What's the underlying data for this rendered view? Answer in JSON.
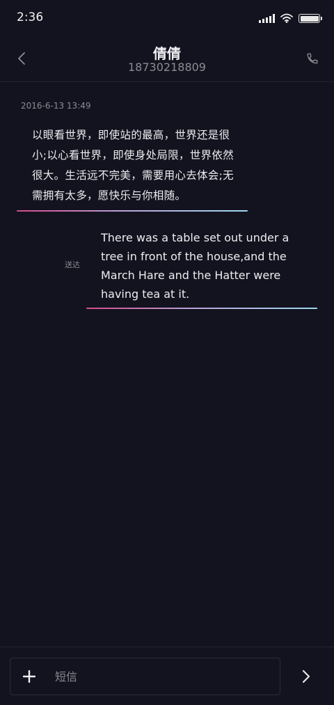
{
  "status_bar": {
    "time": "2:36",
    "icons": [
      "signal-icon",
      "wifi-icon",
      "battery-icon"
    ]
  },
  "header": {
    "contact_name": "倩倩",
    "contact_number": "18730218809",
    "back_icon": "chevron-left-icon",
    "call_icon": "phone-icon"
  },
  "conversation": {
    "timestamp": "2016-6-13 13:49",
    "messages": [
      {
        "direction": "incoming",
        "text": "以眼看世界，即使站的最高，世界还是很小;以心看世界，即使身处局限，世界依然很大。生活远不完美，需要用心去体会;无需拥有太多，愿快乐与你相随。"
      },
      {
        "direction": "outgoing",
        "status": "送达",
        "text": "There was a table set out under a tree in front of the house,and the March Hare and the Hatter were having tea at it."
      }
    ]
  },
  "compose": {
    "placeholder": "短信",
    "value": "",
    "add_icon": "plus-icon",
    "send_icon": "chevron-right-icon"
  },
  "colors": {
    "background": "#13131f",
    "accent_gradient_start": "#d44a8c",
    "accent_gradient_end": "#9fd8f0"
  }
}
